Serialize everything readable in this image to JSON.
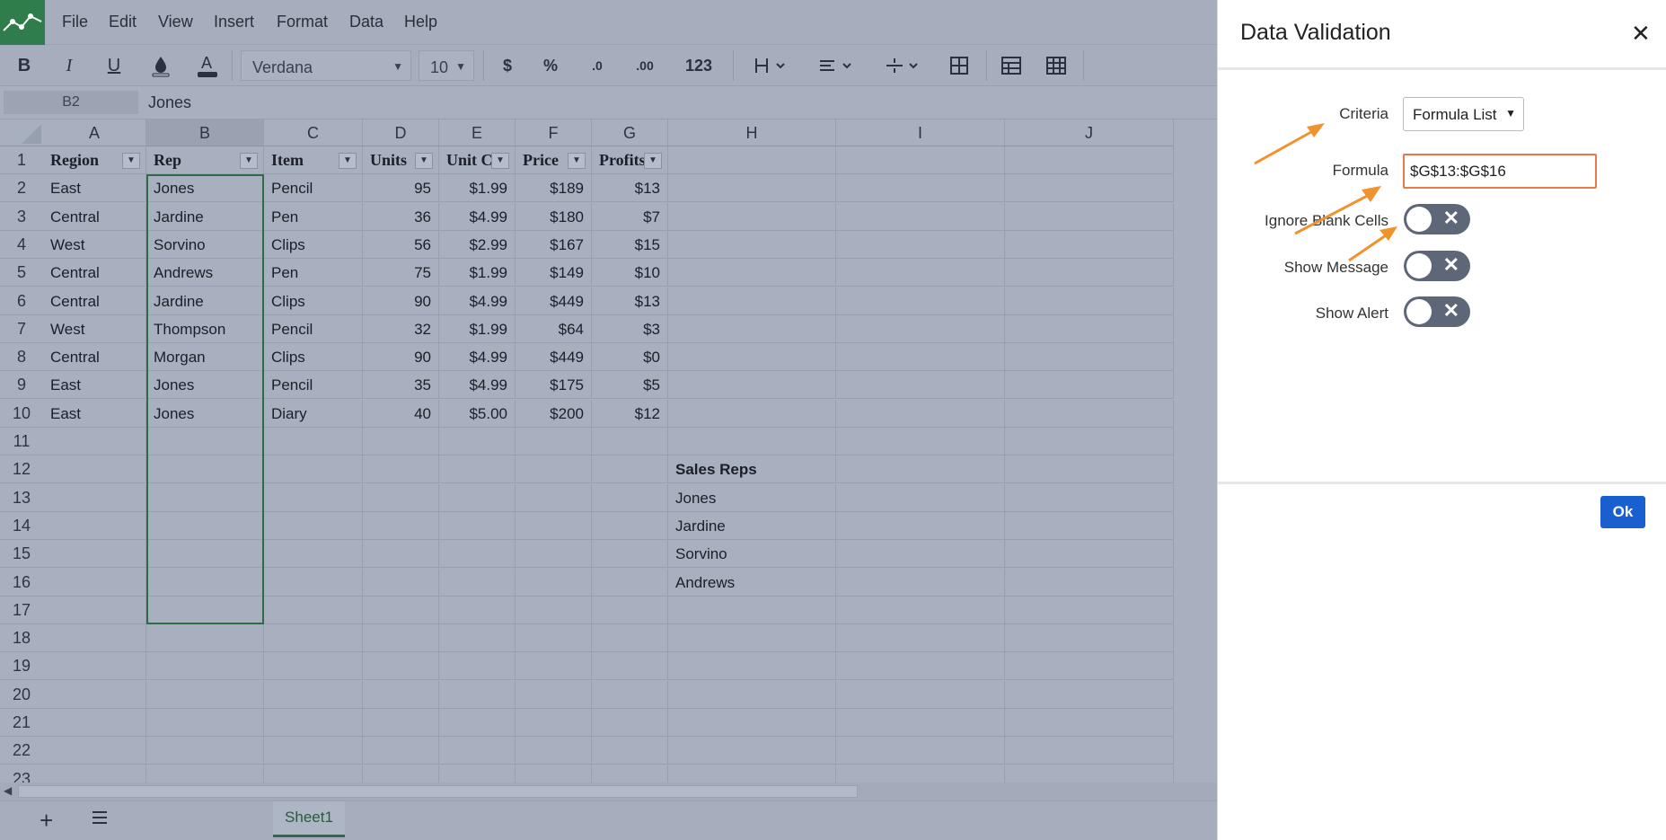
{
  "menu": [
    "File",
    "Edit",
    "View",
    "Insert",
    "Format",
    "Data",
    "Help"
  ],
  "toolbar": {
    "bold": "B",
    "italic": "I",
    "underline": "U",
    "font": "Verdana",
    "size": "10",
    "currency": "$",
    "percent": "%",
    "decimal_dec": ".0",
    "decimal_inc": ".00",
    "number_format": "123"
  },
  "formula_bar": {
    "cell_ref": "B2",
    "content": "Jones"
  },
  "columns": [
    "A",
    "B",
    "C",
    "D",
    "E",
    "F",
    "G",
    "H",
    "I",
    "J"
  ],
  "rows": [
    "1",
    "2",
    "3",
    "4",
    "5",
    "6",
    "7",
    "8",
    "9",
    "10",
    "11",
    "12",
    "13",
    "14",
    "15",
    "16",
    "17",
    "18",
    "19",
    "20",
    "21",
    "22",
    "23"
  ],
  "headers": [
    "Region",
    "Rep",
    "Item",
    "Units",
    "Unit C",
    "Price",
    "Profits"
  ],
  "table": [
    [
      "East",
      "Jones",
      "Pencil",
      "95",
      "$1.99",
      "$189",
      "$13"
    ],
    [
      "Central",
      "Jardine",
      "Pen",
      "36",
      "$4.99",
      "$180",
      "$7"
    ],
    [
      "West",
      "Sorvino",
      "Clips",
      "56",
      "$2.99",
      "$167",
      "$15"
    ],
    [
      "Central",
      "Andrews",
      "Pen",
      "75",
      "$1.99",
      "$149",
      "$10"
    ],
    [
      "Central",
      "Jardine",
      "Clips",
      "90",
      "$4.99",
      "$449",
      "$13"
    ],
    [
      "West",
      "Thompson",
      "Pencil",
      "32",
      "$1.99",
      "$64",
      "$3"
    ],
    [
      "Central",
      "Morgan",
      "Clips",
      "90",
      "$4.99",
      "$449",
      "$0"
    ],
    [
      "East",
      "Jones",
      "Pencil",
      "35",
      "$4.99",
      "$175",
      "$5"
    ],
    [
      "East",
      "Jones",
      "Diary",
      "40",
      "$5.00",
      "$200",
      "$12"
    ]
  ],
  "sales_reps": {
    "title": "Sales Reps",
    "names": [
      "Jones",
      "Jardine",
      "Sorvino",
      "Andrews"
    ]
  },
  "sheet_tab": "Sheet1",
  "dialog": {
    "title": "Data Validation",
    "close": "✕",
    "criteria_label": "Criteria",
    "criteria_value": "Formula List",
    "formula_label": "Formula",
    "formula_value": "$G$13:$G$16",
    "ignore_blank_label": "Ignore Blank Cells",
    "show_message_label": "Show Message",
    "show_alert_label": "Show Alert",
    "ok": "Ok"
  },
  "colors": {
    "accent": "#2f6b45",
    "ok_button": "#1a5fd0",
    "formula_border": "#e8794a",
    "arrow": "#f0922e",
    "toggle_off": "#5e6778"
  }
}
